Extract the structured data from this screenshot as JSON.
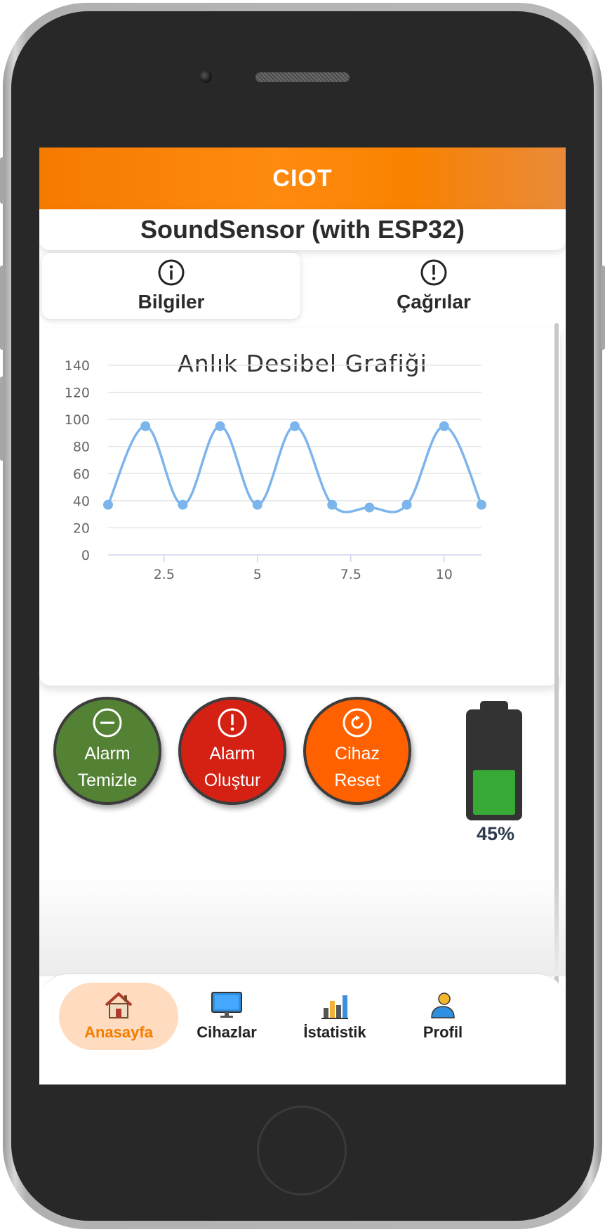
{
  "app": {
    "title": "CIOT"
  },
  "device": {
    "name": "SoundSensor (with ESP32)"
  },
  "tabs": [
    {
      "label": "Bilgiler",
      "icon": "info-circle-icon",
      "active": true
    },
    {
      "label": "Çağrılar",
      "icon": "alert-circle-icon",
      "active": false
    }
  ],
  "chart_data": {
    "type": "line",
    "title": "Anlık Desibel Grafiği",
    "xlabel": "",
    "ylabel": "",
    "x": [
      1,
      2,
      3,
      4,
      5,
      6,
      7,
      8,
      9,
      10,
      11
    ],
    "series": [
      {
        "values": [
          37,
          95,
          37,
          95,
          37,
          95,
          37,
          35,
          37,
          95,
          37
        ]
      }
    ],
    "xlim": [
      1,
      11
    ],
    "ylim": [
      0,
      140
    ],
    "x_ticks": [
      "2.5",
      "5",
      "7.5",
      "10"
    ],
    "y_ticks": [
      "0",
      "20",
      "40",
      "60",
      "80",
      "100",
      "120",
      "140"
    ],
    "grid": true,
    "line_color": "#7cb5ec"
  },
  "actions": [
    {
      "line1": "Alarm",
      "line2": "Temizle",
      "icon": "minus-circle-icon",
      "color": "#548235"
    },
    {
      "line1": "Alarm",
      "line2": "Oluştur",
      "icon": "alert-circle-icon",
      "color": "#d42114"
    },
    {
      "line1": "Cihaz",
      "line2": "Reset",
      "icon": "refresh-icon",
      "color": "#ff6100"
    }
  ],
  "battery": {
    "percent_label": "45%",
    "level": 0.45,
    "fill_color": "#37a935"
  },
  "nav": [
    {
      "label": "Anasayfa",
      "icon": "home-icon",
      "active": true
    },
    {
      "label": "Cihazlar",
      "icon": "monitor-icon",
      "active": false
    },
    {
      "label": "İstatistik",
      "icon": "bar-chart-icon",
      "active": false
    },
    {
      "label": "Profil",
      "icon": "user-icon",
      "active": false
    }
  ],
  "colors": {
    "accent": "#f57c00",
    "nav_active_bg": "#ffdcc0"
  }
}
